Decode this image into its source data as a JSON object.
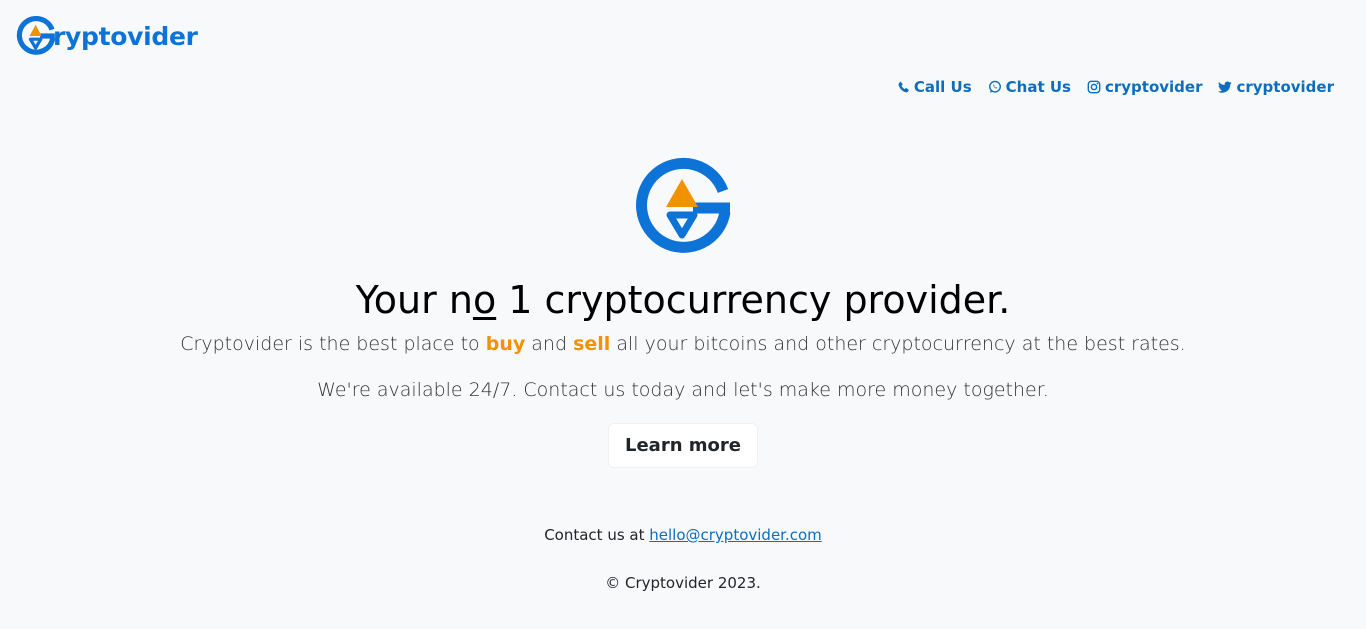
{
  "brand": {
    "name": "ryptovider",
    "colors": {
      "primary": "#0d73d6",
      "accent": "#f39200",
      "background": "#f8f9fa"
    }
  },
  "social": [
    {
      "icon": "phone-icon",
      "label": "Call Us"
    },
    {
      "icon": "whatsapp-icon",
      "label": "Chat Us"
    },
    {
      "icon": "instagram-icon",
      "label": "cryptovider"
    },
    {
      "icon": "twitter-icon",
      "label": "cryptovider"
    }
  ],
  "hero": {
    "title_pre": "Your n",
    "title_underline": "o",
    "title_post": " 1 cryptocurrency provider.",
    "lead1_pre": "Cryptovider is the best place to ",
    "lead1_buy": "buy",
    "lead1_and": " and ",
    "lead1_sell": "sell",
    "lead1_post": " all your bitcoins and other cryptocurrency at the best rates.",
    "lead2": "We're available 24/7. Contact us today and let's make more money together.",
    "button": "Learn more"
  },
  "footer": {
    "contact_prefix": "Contact us at ",
    "email": "hello@cryptovider.com",
    "copyright": "© Cryptovider 2023."
  }
}
